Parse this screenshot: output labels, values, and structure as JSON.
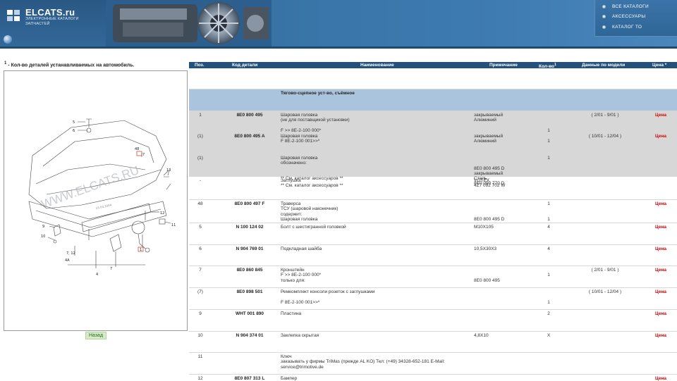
{
  "header": {
    "logo_title": "ELCATS.ru",
    "logo_sub_line1": "ЭЛЕКТРОННЫЕ КАТАЛОГИ",
    "logo_sub_line2": "ЗАПЧАСТЕЙ",
    "nav": [
      {
        "label": "ВСЕ КАТАЛОГИ"
      },
      {
        "label": "АКСЕССУАРЫ"
      },
      {
        "label": "КАТАЛОГ ТО"
      }
    ]
  },
  "left": {
    "note_mark": "1",
    "note": " - Кол-во деталей устанавливаемых на автомобиль.",
    "back_button": "Назад",
    "watermark": "WWW.ELCATS.RU",
    "diagram_labels": {
      "l1": "1",
      "l4": "4",
      "l5": "5",
      "l6": "6",
      "l7": "7",
      "l8": "8",
      "l9": "9",
      "l10": "10",
      "l11": "11",
      "l12": "12",
      "l13": "13",
      "l48": "48",
      "l712": "7, 12",
      "l4a": "4A",
      "date": "23.03.2004"
    }
  },
  "table": {
    "headers": {
      "pos": "Поз.",
      "code": "Код детали",
      "name": "Наименование",
      "note": "Примечание",
      "qty": "Кол-во",
      "qty_mark": "1",
      "model": "Данные по модели",
      "price": "Цена *"
    },
    "group_title": "Тягово-сцепное уст-во, съёмное",
    "rows": [
      {
        "pos": "1",
        "code": "8E0 800 495",
        "name": "Шаровая головка\n(не для поставщикой установки)\n\nF >> 8E-2-100 000*",
        "note": "закрываемый\nАлюминий",
        "qty": "\n\n\n1",
        "model": "( 2/01 - 9/01 )",
        "price": "Цена"
      },
      {
        "pos": "(1)",
        "code": "8E0 800 495 A",
        "name": "Шаровая головка\nF 8E-2-100 001>>*",
        "note": "закрываемый\nАлюминий",
        "qty": "\n1",
        "model": "( 10/01 - 12/04 )",
        "price": "Цена"
      },
      {
        "pos": "(1)",
        "code": "",
        "name": "Шаровая головка\nобозначено:\n\n\n** См. каталог аксессуаров **",
        "note": "\n\n8E0 800 495 D\nзакрываемый\nСталь\n8E0 090 770 D",
        "qty": "1",
        "model": "",
        "price": ""
      },
      {
        "pos": "-",
        "code": "",
        "name": "Заглушка\n** См. каталог аксессуаров **",
        "note": "VOTEX\n4Z7 092 702 W",
        "qty": "",
        "model": "",
        "price": ""
      },
      {
        "pos": "48",
        "code": "8E0 800 497 F",
        "name": "Траверса\nТСУ (шаровой наконечник)\nсодержит:\nШаровая головка",
        "note": "\n\n\n8E0 800 495 D",
        "qty": "1\n\n\n1",
        "model": "",
        "price": "Цена"
      },
      {
        "pos": "5",
        "code": "N 100 124 02",
        "name": "Болт с шестигранной головкой",
        "note": "M10X105",
        "qty": "4",
        "model": "",
        "price": "Цена"
      },
      {
        "pos": "6",
        "code": "N 904 769 01",
        "name": "Подкладная шайба",
        "note": "10,5X30X3",
        "qty": "4",
        "model": "",
        "price": "Цена"
      },
      {
        "pos": "7",
        "code": "8E0 860 845",
        "name": "Кронштейн\nF >> 8E-2-100 000*\nтолько для:",
        "note": "\n\n8E0 800 495",
        "qty": "\n1",
        "model": "( 2/01 - 9/01 )",
        "price": "Цена"
      },
      {
        "pos": "(7)",
        "code": "8E0 898 501",
        "name": "Ремкомплект консоли розеток с заглушками\n\nF 8E-2-100 001>>*",
        "note": "",
        "qty": "\n\n1",
        "model": "( 10/01 - 12/04 )",
        "price": "Цена"
      },
      {
        "pos": "9",
        "code": "WHT 001 890",
        "name": "Пластина",
        "note": "",
        "qty": "2",
        "model": "",
        "price": "Цена"
      },
      {
        "pos": "10",
        "code": "N 904 374 01",
        "name": "Заклепка скрытая",
        "note": "4,8X10",
        "qty": "X",
        "model": "",
        "price": "Цена"
      },
      {
        "pos": "11",
        "code": "",
        "name": "Ключ\nзаказывать у фирмы TriMas (прежде AL KO) Тел: (+49) 34328-652-181 E-Mail:\nservice@trimotive.de",
        "note": "",
        "qty": "",
        "model": "",
        "price": ""
      },
      {
        "pos": "12",
        "code": "8E0 807 313 L",
        "name": "Бампер",
        "note": "",
        "qty": "",
        "model": "",
        "price": "Цена"
      }
    ]
  }
}
